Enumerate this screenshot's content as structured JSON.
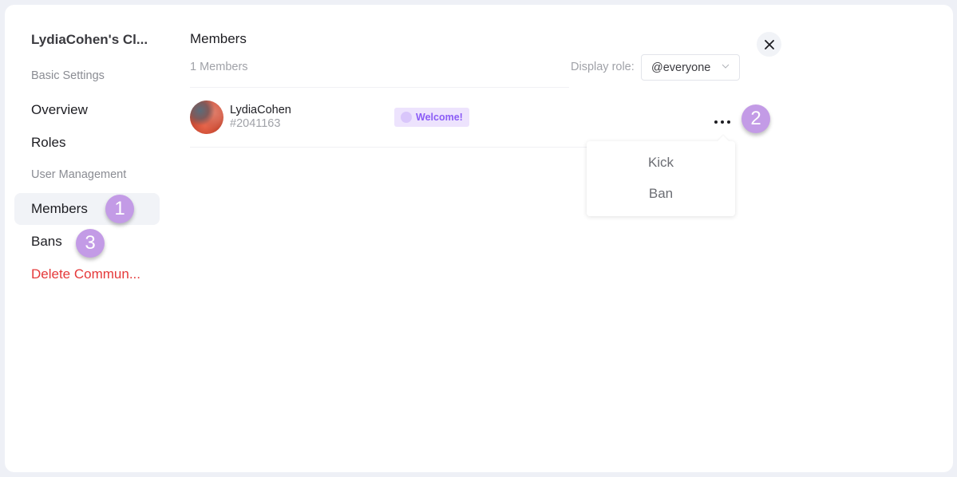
{
  "sidebar": {
    "community_title": "LydiaCohen's Cl...",
    "sections": [
      {
        "label": "Basic Settings"
      },
      {
        "label": "User Management"
      }
    ],
    "items": [
      {
        "label": "Overview"
      },
      {
        "label": "Roles"
      },
      {
        "label": "Members",
        "active": true
      },
      {
        "label": "Bans"
      },
      {
        "label": "Delete Commun..."
      }
    ]
  },
  "main": {
    "title": "Members",
    "member_count": "1 Members",
    "display_role_label": "Display role:",
    "display_role_value": "@everyone",
    "members": [
      {
        "name": "LydiaCohen",
        "tag": "#2041163",
        "role": "Welcome!"
      }
    ]
  },
  "context_menu": {
    "items": [
      {
        "label": "Kick"
      },
      {
        "label": "Ban"
      }
    ]
  },
  "annotations": {
    "step1": "1",
    "step2": "2",
    "step3": "3"
  },
  "colors": {
    "danger": "#e5393a",
    "role_badge_text": "#8b5cf6",
    "role_badge_bg": "#ede3fd",
    "annotation": "#c39be6"
  }
}
